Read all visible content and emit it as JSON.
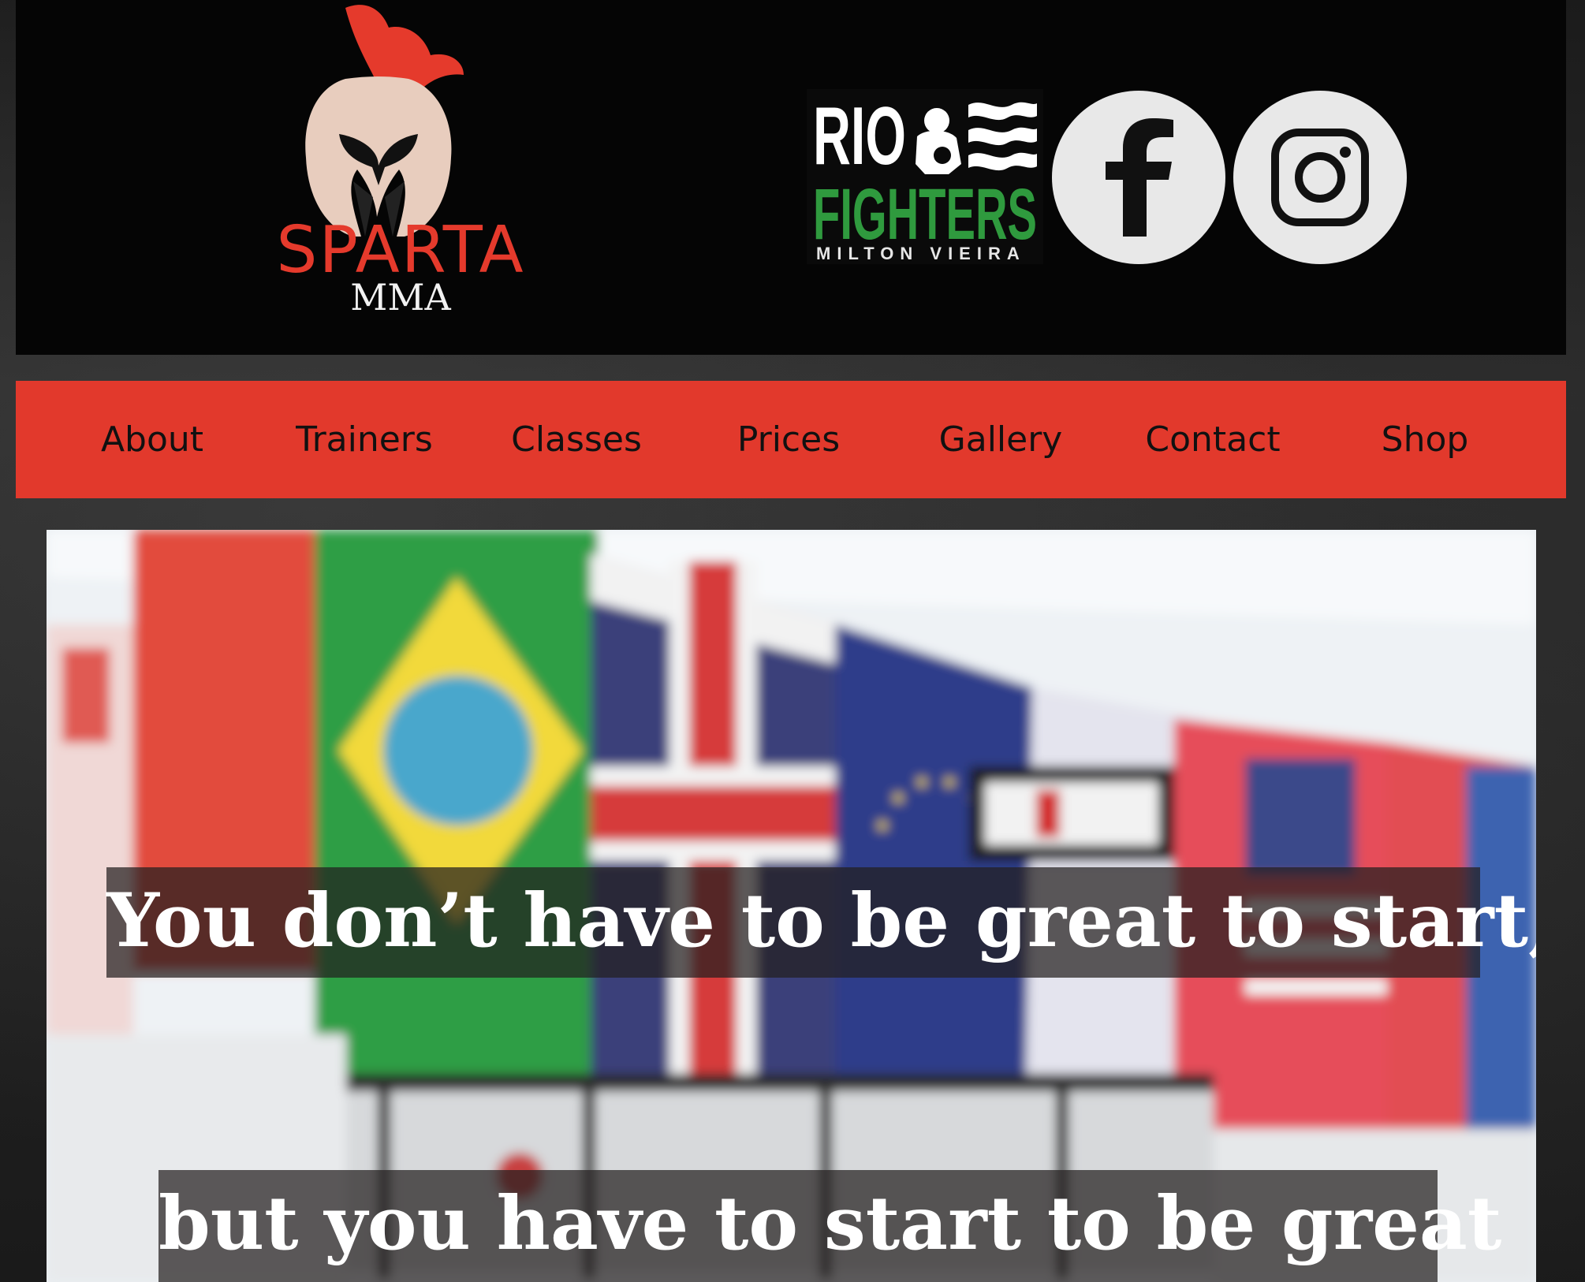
{
  "brand": {
    "name": "SPARTA",
    "subtitle": "MMA",
    "icon": "spartan-helmet-icon"
  },
  "partner": {
    "line1": "RIO",
    "line2": "FIGHTERS",
    "line3": "MILTON VIEIRA",
    "icon": "fighter-icon"
  },
  "social": {
    "facebook_icon": "facebook-icon",
    "instagram_icon": "instagram-icon"
  },
  "nav": {
    "items": [
      "About",
      "Trainers",
      "Classes",
      "Prices",
      "Gallery",
      "Contact",
      "Shop"
    ]
  },
  "hero": {
    "quote_line1": "You don’t have to be great to start,",
    "quote_line2": "but you have to start to be great"
  },
  "colors": {
    "nav_red": "#e2392c",
    "brand_red": "#e53a2c",
    "header_black": "#050505",
    "partner_green": "#2f9a3e"
  }
}
